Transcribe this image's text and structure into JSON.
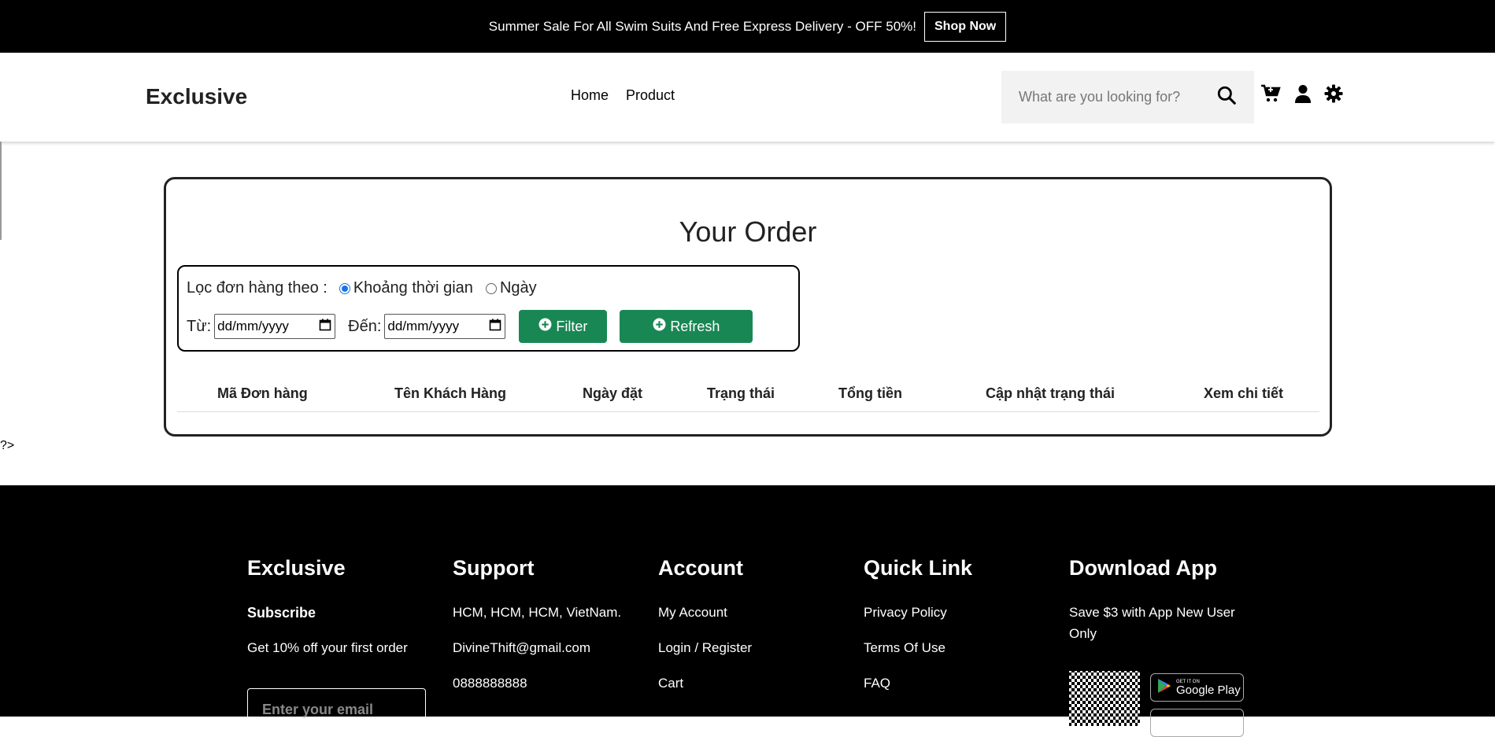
{
  "topbar": {
    "message": "Summer Sale For All Swim Suits And Free Express Delivery - OFF 50%!",
    "cta": "Shop Now"
  },
  "header": {
    "logo": "Exclusive",
    "nav": [
      "Home",
      "Product"
    ],
    "search_placeholder": "What are you looking for?",
    "icons": [
      "search-icon",
      "cart-icon",
      "user-icon",
      "settings-icon"
    ]
  },
  "stray_text": "?>",
  "orders": {
    "title": "Your Order",
    "filter_label": "Lọc đơn hàng theo :",
    "radio_range": "Khoảng thời gian",
    "radio_day": "Ngày",
    "from_label": "Từ:",
    "to_label": "Đến:",
    "date_placeholder": "dd/mm/yyyy",
    "filter_btn": "Filter",
    "refresh_btn": "Refresh",
    "columns": [
      "Mã Đơn hàng",
      "Tên Khách Hàng",
      "Ngày đặt",
      "Trạng thái",
      "Tổng tiền",
      "Cập nhật trạng thái",
      "Xem chi tiết"
    ]
  },
  "footer": {
    "col1": {
      "title": "Exclusive",
      "subtitle": "Subscribe",
      "text": "Get 10% off your first order",
      "email_placeholder": "Enter your email"
    },
    "col2": {
      "title": "Support",
      "items": [
        "HCM, HCM, HCM, VietNam.",
        "DivineThift@gmail.com",
        "0888888888"
      ]
    },
    "col3": {
      "title": "Account",
      "items": [
        "My Account",
        "Login / Register",
        "Cart"
      ]
    },
    "col4": {
      "title": "Quick Link",
      "items": [
        "Privacy Policy",
        "Terms Of Use",
        "FAQ"
      ]
    },
    "col5": {
      "title": "Download App",
      "text1": "Save $3 with App New User",
      "text2": "Only",
      "gp_small": "GET IT ON",
      "gp_big": "Google Play"
    }
  }
}
